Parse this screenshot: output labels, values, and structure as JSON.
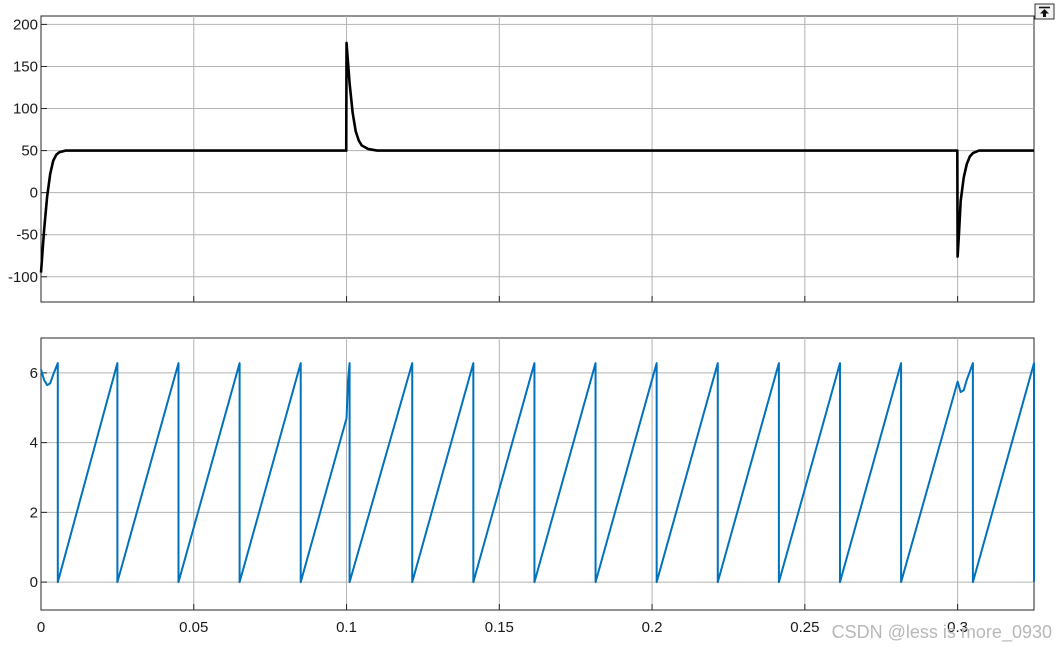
{
  "chart_data": [
    {
      "type": "line",
      "title": "",
      "xlabel": "",
      "ylabel": "",
      "xlim": [
        0,
        0.325
      ],
      "ylim": [
        -130,
        210
      ],
      "grid": true,
      "xticks": [
        0,
        0.05,
        0.1,
        0.15,
        0.2,
        0.25,
        0.3
      ],
      "yticks": [
        -100,
        -50,
        0,
        50,
        100,
        150,
        200
      ],
      "ytick_labels": [
        "-100",
        "-50",
        "0",
        "50",
        "100",
        "150",
        "200"
      ],
      "series": [
        {
          "color": "#000000",
          "points": [
            [
              0,
              -95
            ],
            [
              0.001,
              -45
            ],
            [
              0.002,
              -5
            ],
            [
              0.003,
              22
            ],
            [
              0.004,
              38
            ],
            [
              0.005,
              45
            ],
            [
              0.006,
              48
            ],
            [
              0.008,
              50
            ],
            [
              0.0999,
              50
            ],
            [
              0.1,
              178
            ],
            [
              0.101,
              130
            ],
            [
              0.102,
              95
            ],
            [
              0.103,
              73
            ],
            [
              0.104,
              62
            ],
            [
              0.105,
              56
            ],
            [
              0.107,
              52
            ],
            [
              0.11,
              50
            ],
            [
              0.2999,
              50
            ],
            [
              0.3,
              -76
            ],
            [
              0.3005,
              -45
            ],
            [
              0.301,
              -10
            ],
            [
              0.302,
              18
            ],
            [
              0.303,
              34
            ],
            [
              0.304,
              43
            ],
            [
              0.305,
              47
            ],
            [
              0.307,
              50
            ],
            [
              0.325,
              50
            ]
          ]
        }
      ]
    },
    {
      "type": "line",
      "title": "",
      "xlabel": "",
      "ylabel": "",
      "xlim": [
        0,
        0.325
      ],
      "ylim": [
        -0.8,
        7.0
      ],
      "grid": true,
      "xticks": [
        0,
        0.05,
        0.1,
        0.15,
        0.2,
        0.25,
        0.3
      ],
      "xtick_labels": [
        "0",
        "0.05",
        "0.1",
        "0.15",
        "0.2",
        "0.25",
        "0.3"
      ],
      "yticks": [
        0,
        2,
        4,
        6
      ],
      "ytick_labels": [
        "0",
        "2",
        "4",
        "6"
      ],
      "series": [
        {
          "color": "#0072bd",
          "points": [
            [
              0,
              6.1
            ],
            [
              0.001,
              5.8
            ],
            [
              0.002,
              5.65
            ],
            [
              0.003,
              5.7
            ],
            [
              0.004,
              5.95
            ],
            [
              0.0055,
              6.28
            ],
            [
              0.0055,
              0
            ],
            [
              0.025,
              6.28
            ],
            [
              0.025,
              0
            ],
            [
              0.045,
              6.28
            ],
            [
              0.045,
              0
            ],
            [
              0.065,
              6.28
            ],
            [
              0.065,
              0
            ],
            [
              0.085,
              6.28
            ],
            [
              0.085,
              0
            ],
            [
              0.1,
              4.7
            ],
            [
              0.1005,
              5.8
            ],
            [
              0.101,
              6.28
            ],
            [
              0.101,
              0
            ],
            [
              0.1215,
              6.28
            ],
            [
              0.1215,
              0
            ],
            [
              0.1415,
              6.28
            ],
            [
              0.1415,
              0
            ],
            [
              0.1615,
              6.28
            ],
            [
              0.1615,
              0
            ],
            [
              0.1815,
              6.28
            ],
            [
              0.1815,
              0
            ],
            [
              0.2015,
              6.28
            ],
            [
              0.2015,
              0
            ],
            [
              0.2215,
              6.28
            ],
            [
              0.2215,
              0
            ],
            [
              0.2415,
              6.28
            ],
            [
              0.2415,
              0
            ],
            [
              0.2615,
              6.28
            ],
            [
              0.2615,
              0
            ],
            [
              0.2815,
              6.28
            ],
            [
              0.2815,
              0
            ],
            [
              0.3,
              5.75
            ],
            [
              0.301,
              5.45
            ],
            [
              0.302,
              5.5
            ],
            [
              0.303,
              5.8
            ],
            [
              0.305,
              6.28
            ],
            [
              0.305,
              0
            ],
            [
              0.325,
              6.28
            ],
            [
              0.325,
              0
            ]
          ]
        }
      ]
    }
  ],
  "toolbar": {
    "restore_icon": "arrow-up-bar-icon"
  },
  "watermark": "CSDN @less is more_0930"
}
